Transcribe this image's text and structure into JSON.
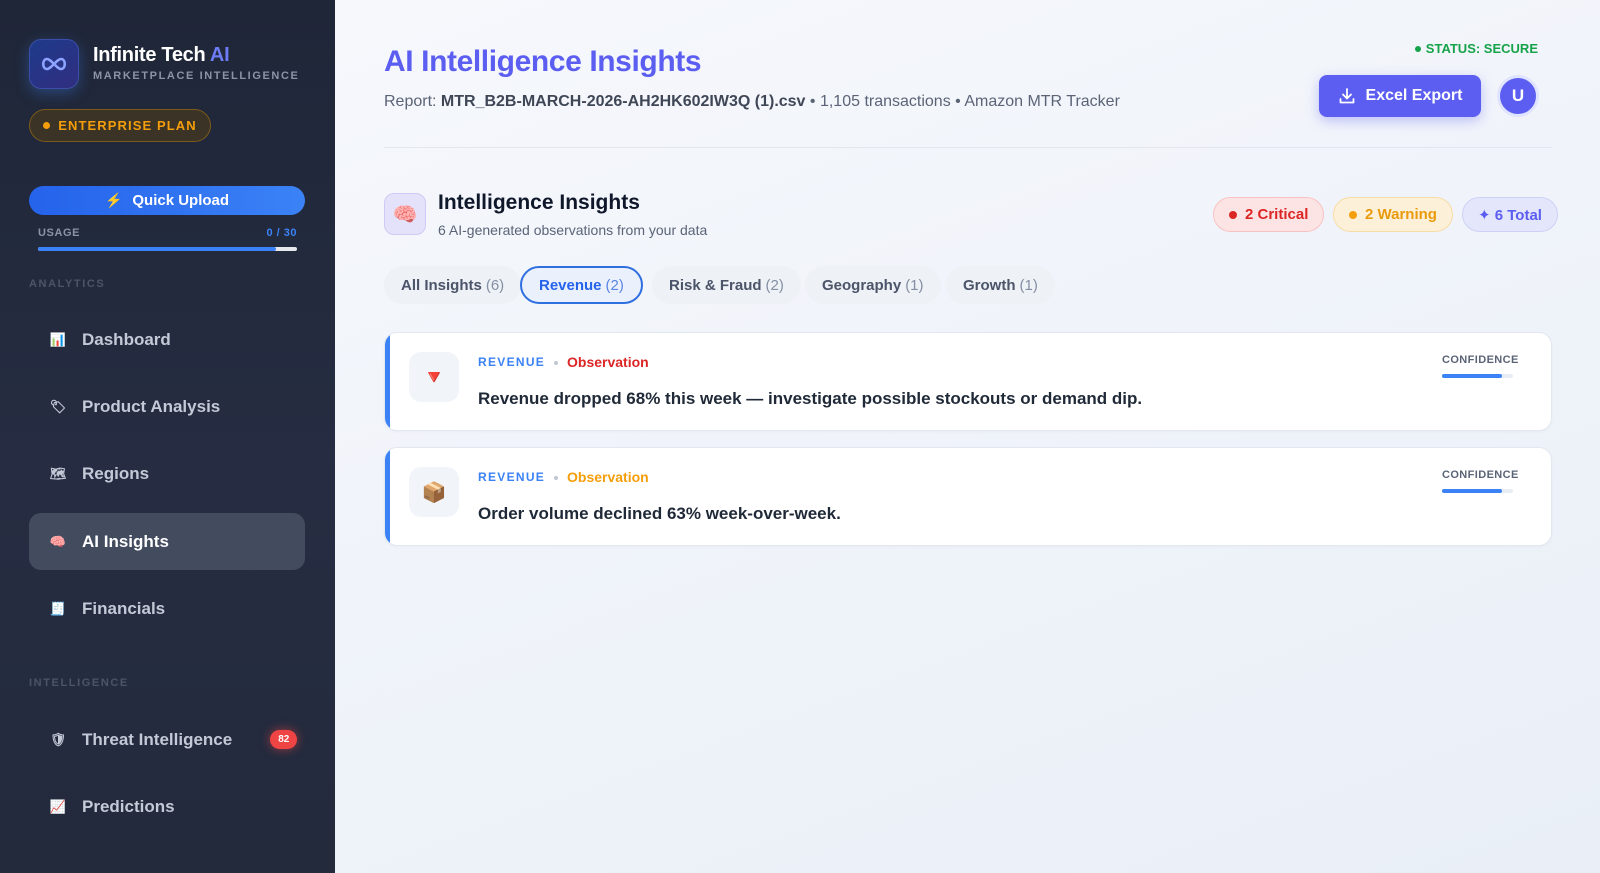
{
  "sidebar": {
    "brand_name": "Infinite Tech",
    "brand_ai": "AI",
    "brand_sub": "MARKETPLACE INTELLIGENCE",
    "plan": "ENTERPRISE PLAN",
    "upload_label": "Quick Upload",
    "usage_label": "USAGE",
    "usage_value": "0 / 30",
    "usage_fraction": 0.92,
    "sections": {
      "analytics": "ANALYTICS",
      "intelligence": "INTELLIGENCE"
    },
    "items": [
      {
        "label": "Dashboard",
        "icon": "bar-chart-icon",
        "glyph": "📊"
      },
      {
        "label": "Product Analysis",
        "icon": "tag-icon",
        "glyph": "🏷"
      },
      {
        "label": "Regions",
        "icon": "map-icon",
        "glyph": "🗺"
      },
      {
        "label": "AI Insights",
        "icon": "brain-icon",
        "glyph": "🧠"
      },
      {
        "label": "Financials",
        "icon": "receipt-icon",
        "glyph": "🧾"
      },
      {
        "label": "Threat Intelligence",
        "icon": "shield-icon",
        "glyph": "🛡",
        "badge": "82"
      },
      {
        "label": "Predictions",
        "icon": "trend-chart-icon",
        "glyph": "📈"
      }
    ]
  },
  "header": {
    "title": "AI Intelligence Insights",
    "report_prefix": "Report:",
    "report_file": "MTR_B2B-MARCH-2026-AH2HK602IW3Q (1).csv",
    "report_meta": "• 1,105 transactions • Amazon MTR Tracker",
    "status": "STATUS: SECURE",
    "export_label": "Excel Export",
    "avatar_initial": "U"
  },
  "insights": {
    "title": "Intelligence Insights",
    "subtitle": "6 AI-generated observations from your data",
    "pills": {
      "critical": "2 Critical",
      "warning": "2 Warning",
      "total": "✦ 6 Total"
    },
    "tabs": [
      {
        "label": "All Insights",
        "count": "(6)"
      },
      {
        "label": "Revenue",
        "count": "(2)"
      },
      {
        "label": "Risk & Fraud",
        "count": "(2)"
      },
      {
        "label": "Geography",
        "count": "(1)"
      },
      {
        "label": "Growth",
        "count": "(1)"
      }
    ],
    "cards": [
      {
        "category": "REVENUE",
        "type": "Observation",
        "type_color": "#dc2626",
        "icon": "red-triangle-down-icon",
        "glyph": "🔻",
        "text": "Revenue dropped 68% this week — investigate possible stockouts or demand dip.",
        "confidence_label": "CONFIDENCE",
        "confidence": 0.85
      },
      {
        "category": "REVENUE",
        "type": "Observation",
        "type_color": "#f59e0b",
        "icon": "package-icon",
        "glyph": "📦",
        "text": "Order volume declined 63% week-over-week.",
        "confidence_label": "CONFIDENCE",
        "confidence": 0.85
      }
    ]
  },
  "colors": {
    "accent": "#5b5ef0",
    "blue": "#3b82f6",
    "critical": "#dc2626",
    "warning": "#f59e0b",
    "success": "#16a34a",
    "sidebar_bg": "#1f2638"
  }
}
